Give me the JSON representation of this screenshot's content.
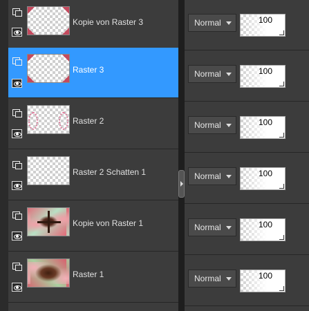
{
  "layers": [
    {
      "name": "Kopie von Raster 3",
      "blend_mode": "Normal",
      "opacity": "100",
      "selected": false,
      "thumb": "corners"
    },
    {
      "name": "Raster 3",
      "blend_mode": "Normal",
      "opacity": "100",
      "selected": true,
      "thumb": "corners"
    },
    {
      "name": "Raster 2",
      "blend_mode": "Normal",
      "opacity": "100",
      "selected": false,
      "thumb": "swirls"
    },
    {
      "name": "Raster 2 Schatten 1",
      "blend_mode": "Normal",
      "opacity": "100",
      "selected": false,
      "thumb": "empty"
    },
    {
      "name": "Kopie von Raster 1",
      "blend_mode": "Normal",
      "opacity": "100",
      "selected": false,
      "thumb": "mandala-cross"
    },
    {
      "name": "Raster 1",
      "blend_mode": "Normal",
      "opacity": "100",
      "selected": false,
      "thumb": "mandala"
    }
  ],
  "icons": {
    "group": "layer-group-icon",
    "visibility": "eye-icon",
    "dropdown": "chevron-down-icon",
    "splitter": "chevron-right-icon"
  },
  "colors": {
    "selection": "#3399ff",
    "panel": "#3c3c3c",
    "separator": "#262626",
    "accent_pink": "#c44a5e"
  }
}
